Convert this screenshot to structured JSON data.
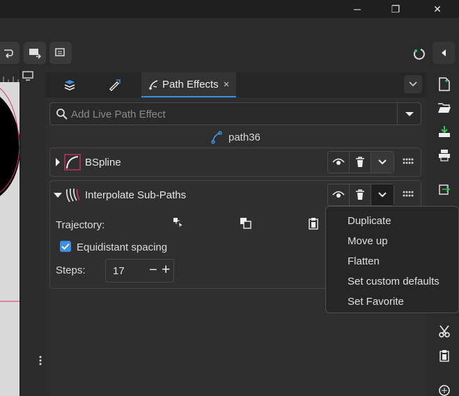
{
  "window": {
    "minimize": "─",
    "restore": "❐",
    "close": "✕"
  },
  "dialog": {
    "active_tab": {
      "label": "Path Effects",
      "close": "×"
    },
    "search": {
      "placeholder": "Add Live Path Effect"
    },
    "path_name": "path36",
    "effects": [
      {
        "name": "BSpline",
        "expanded": false
      },
      {
        "name": "Interpolate Sub-Paths",
        "expanded": true,
        "params": {
          "trajectory_label": "Trajectory:",
          "equidistant_label": "Equidistant spacing",
          "equidistant_checked": true,
          "steps_label": "Steps:",
          "steps_value": "17",
          "steps_minus": "−",
          "steps_plus": "+"
        }
      }
    ],
    "context_menu": [
      "Duplicate",
      "Move up",
      "Flatten",
      "Set custom defaults",
      "Set Favorite"
    ]
  },
  "colors": {
    "accent": "#3d8de0",
    "spline": "#e0306a"
  }
}
